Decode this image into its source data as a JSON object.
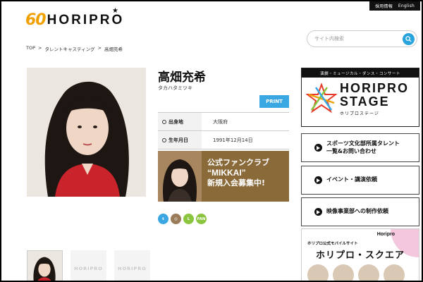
{
  "topbar": {
    "recruit": "採用情報",
    "english": "English"
  },
  "logo": {
    "number": "60",
    "name": "HORIPRO"
  },
  "search": {
    "placeholder": "サイト内検索"
  },
  "breadcrumb": [
    "TOP",
    ">",
    "タレントキャスティング",
    ">",
    "高畑充希"
  ],
  "talent": {
    "name": "高畑充希",
    "kana": "タカハタミツキ",
    "print_label": "PRINT",
    "profile": [
      {
        "label": "出身地",
        "value": "大阪府"
      },
      {
        "label": "生年月日",
        "value": "1991年12月14日"
      }
    ]
  },
  "fanclub": {
    "line1": "公式ファンクラブ",
    "line2": "“MIKKAI”",
    "line3": "新規入会募集中!"
  },
  "social": [
    {
      "name": "twitter-icon",
      "glyph": "t",
      "color": "#3aa7e3"
    },
    {
      "name": "instagram-icon",
      "glyph": "◎",
      "color": "#9a7b5a"
    },
    {
      "name": "line-icon",
      "glyph": "L",
      "color": "#8bc53f"
    },
    {
      "name": "fan-icon",
      "glyph": "FAN",
      "color": "#8bc53f"
    }
  ],
  "thumbnails": {
    "placeholder": "HORIPRO"
  },
  "stage_banner": {
    "header": "演劇・ミュージカル・ダンス・コンサート",
    "line1": "HORIPRO",
    "line2": "STAGE",
    "line3": "ホリプロステージ"
  },
  "nav_links": [
    {
      "name": "sports-culture-link",
      "line1": "スポーツ文化部所属タレント",
      "line2": "一覧&お問い合わせ"
    },
    {
      "name": "events-link",
      "line1": "イベント・講演依頼",
      "line2": ""
    },
    {
      "name": "video-production-link",
      "line1": "映像事業部への制作依頼",
      "line2": ""
    }
  ],
  "square_banner": {
    "brand": "Horipro",
    "subtitle": "ホリプロ公式モバイルサイト",
    "title": "ホリプロ・スクエア"
  }
}
